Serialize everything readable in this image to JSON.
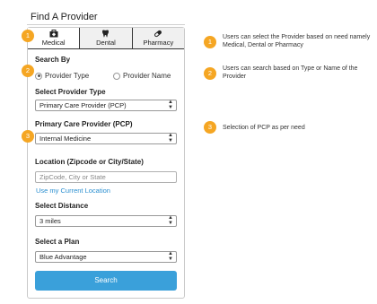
{
  "page": {
    "title": "Find A Provider"
  },
  "tabs": [
    {
      "label": "Medical",
      "icon": "medical-bag-icon",
      "active": true
    },
    {
      "label": "Dental",
      "icon": "tooth-icon",
      "active": false
    },
    {
      "label": "Pharmacy",
      "icon": "pill-icon",
      "active": false
    }
  ],
  "search_by": {
    "label": "Search By",
    "options": [
      {
        "label": "Provider Type",
        "selected": true
      },
      {
        "label": "Provider Name",
        "selected": false
      }
    ]
  },
  "provider_type": {
    "label": "Select Provider Type",
    "value": "Primary Care Provider (PCP)"
  },
  "pcp": {
    "label": "Primary Care Provider (PCP)",
    "value": "Internal Medicine"
  },
  "location": {
    "label": "Location (Zipcode or City/State)",
    "placeholder": "ZipCode, City or State",
    "link": "Use my Current Location"
  },
  "distance": {
    "label": "Select Distance",
    "value": "3 miles"
  },
  "plan": {
    "label": "Select a Plan",
    "value": "Blue Advantage"
  },
  "search_button": "Search",
  "badges": [
    "1",
    "2",
    "3"
  ],
  "notes": [
    "Users can select the Provider based on need namely Medical, Dental or Pharmacy",
    "Users can search based on Type or Name of the Provider",
    "Selection of PCP as per need"
  ],
  "colors": {
    "accent": "#3aa0da",
    "badge": "#f5a623",
    "link": "#2b8fd0"
  }
}
